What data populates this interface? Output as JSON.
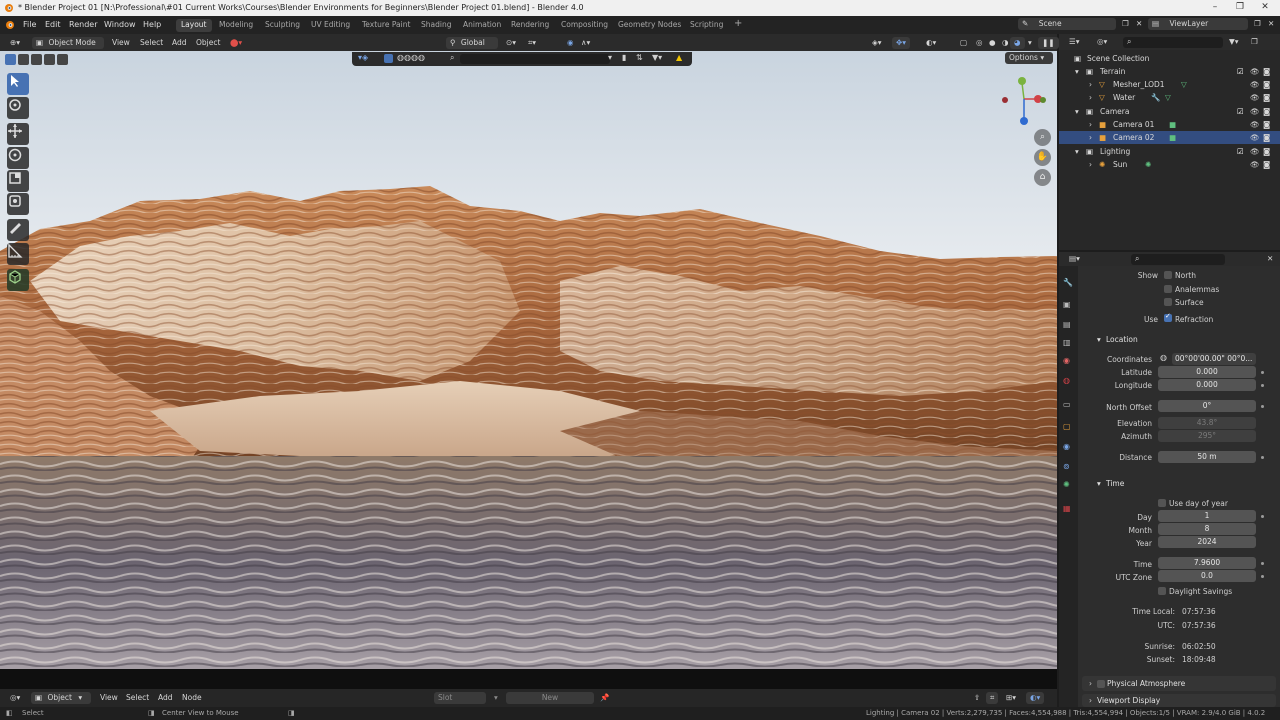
{
  "window": {
    "title": "* Blender Project 01 [N:\\Professional\\#01 Current Works\\Courses\\Blender Environments for Beginners\\Blender Project 01.blend] - Blender 4.0"
  },
  "menu": [
    "File",
    "Edit",
    "Render",
    "Window",
    "Help"
  ],
  "workspaces": [
    "Layout",
    "Modeling",
    "Sculpting",
    "UV Editing",
    "Texture Paint",
    "Shading",
    "Animation",
    "Rendering",
    "Compositing",
    "Geometry Nodes",
    "Scripting"
  ],
  "active_workspace": "Layout",
  "scene": {
    "name": "Scene",
    "view_layer": "ViewLayer"
  },
  "viewport_header": {
    "mode": "Object Mode",
    "menus": [
      "View",
      "Select",
      "Add",
      "Object"
    ],
    "transform_orientation": "Global",
    "options_label": "Options"
  },
  "outliner": {
    "root": "Scene Collection",
    "rows": [
      {
        "label": "Terrain",
        "kind": "collection"
      },
      {
        "label": "Mesher_LOD1",
        "kind": "mesh"
      },
      {
        "label": "Water",
        "kind": "mesh"
      },
      {
        "label": "Camera",
        "kind": "collection"
      },
      {
        "label": "Camera 01",
        "kind": "camera"
      },
      {
        "label": "Camera 02",
        "kind": "camera",
        "selected": true
      },
      {
        "label": "Lighting",
        "kind": "collection"
      },
      {
        "label": "Sun",
        "kind": "light"
      }
    ]
  },
  "properties": {
    "show_label": "Show",
    "show_options": [
      {
        "label": "North",
        "checked": false
      },
      {
        "label": "Analemmas",
        "checked": false
      },
      {
        "label": "Surface",
        "checked": false
      }
    ],
    "use_label": "Use",
    "use_refraction": {
      "label": "Refraction",
      "checked": true
    },
    "location_section": "Location",
    "coordinates": {
      "label": "Coordinates",
      "value": "00°00'00.00\" 00°0..."
    },
    "latitude": {
      "label": "Latitude",
      "value": "0.000"
    },
    "longitude": {
      "label": "Longitude",
      "value": "0.000"
    },
    "north_offset": {
      "label": "North Offset",
      "value": "0°"
    },
    "elevation": {
      "label": "Elevation",
      "value": "43.8°"
    },
    "azimuth": {
      "label": "Azimuth",
      "value": "295°"
    },
    "distance": {
      "label": "Distance",
      "value": "50 m"
    },
    "time_section": "Time",
    "use_day_of_year": {
      "label": "Use day of year",
      "checked": false
    },
    "day": {
      "label": "Day",
      "value": "1"
    },
    "month": {
      "label": "Month",
      "value": "8"
    },
    "year": {
      "label": "Year",
      "value": "2024"
    },
    "time": {
      "label": "Time",
      "value": "7.9600"
    },
    "utc_zone": {
      "label": "UTC Zone",
      "value": "0.0"
    },
    "daylight_savings": {
      "label": "Daylight Savings",
      "checked": false
    },
    "time_local": {
      "label": "Time Local:",
      "value": "07:57:36"
    },
    "utc": {
      "label": "UTC:",
      "value": "07:57:36"
    },
    "sunrise": {
      "label": "Sunrise:",
      "value": "06:02:50"
    },
    "sunset": {
      "label": "Sunset:",
      "value": "18:09:48"
    },
    "physical_atmosphere": "Physical Atmosphere",
    "viewport_display": "Viewport Display"
  },
  "bottom_header": {
    "editor": "Object",
    "menus": [
      "View",
      "Select",
      "Add",
      "Node"
    ],
    "slot": "Slot",
    "new_label": "New"
  },
  "statusbar": {
    "left": "Select",
    "middle": "Center View to Mouse",
    "right": "Lighting | Camera 02 | Verts:2,279,735 | Faces:4,554,988 | Tris:4,554,994 | Objects:1/5 | VRAM: 2.9/4.0 GiB | 4.0.2"
  },
  "colors": {
    "accent": "#4772b3",
    "selection": "#334d80",
    "collection_icon": "#e8e8e8",
    "mesh_icon": "#e6a03c",
    "camera_icon": "#e6a03c",
    "data_icon_green": "#5fbf7f"
  }
}
